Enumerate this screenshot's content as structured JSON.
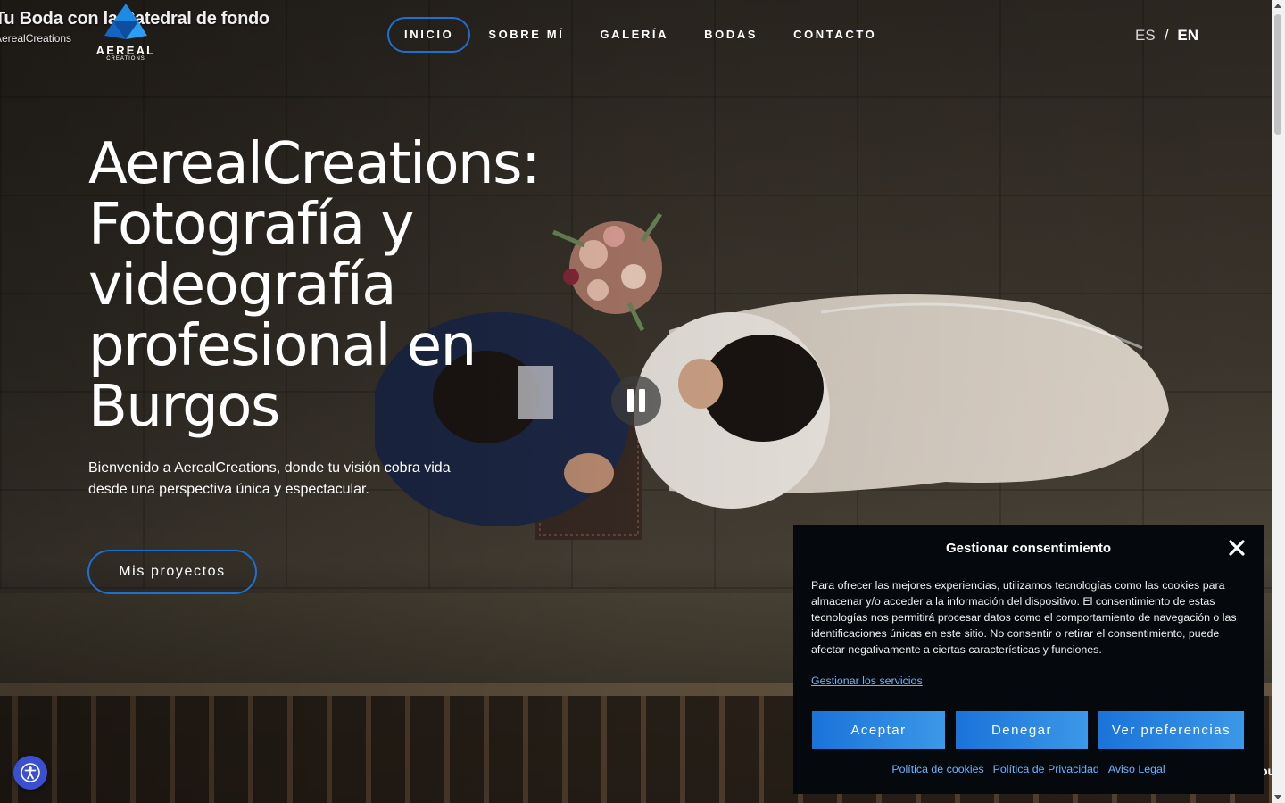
{
  "video": {
    "title": "Tu Boda con la Catedral de fondo",
    "channel": "AerealCreations",
    "pause_icon": "pause-icon"
  },
  "logo": {
    "word": "AEREAL",
    "sub": "CREATIONS",
    "color": "#1e8ae6"
  },
  "nav": {
    "items": [
      "INICIO",
      "SOBRE MÍ",
      "GALERÍA",
      "BODAS",
      "CONTACTO"
    ],
    "active_index": 0,
    "active_border_color": "#1e6fd1"
  },
  "lang": {
    "es": "ES",
    "separator": "/",
    "en": "EN"
  },
  "hero": {
    "title": "AerealCreations: Fotografía y videografía profesional en Burgos",
    "subtitle": "Bienvenido a AerealCreations, donde tu visión cobra vida desde una perspectiva única y espectacular.",
    "cta_label": "Mis proyectos"
  },
  "consent": {
    "title": "Gestionar consentimiento",
    "text": "Para ofrecer las mejores experiencias, utilizamos tecnologías como las cookies para almacenar y/o acceder a la información del dispositivo. El consentimiento de estas tecnologías nos permitirá procesar datos como el comportamiento de navegación o las identificaciones únicas en este sitio. No consentir o retirar el consentimiento, puede afectar negativamente a ciertas características y funciones.",
    "manage_link": "Gestionar los servicios",
    "accept": "Aceptar",
    "deny": "Denegar",
    "preferences": "Ver preferencias",
    "links": [
      "Política de cookies",
      "Política de Privacidad",
      "Aviso Legal"
    ],
    "button_color": "#1a73d9",
    "link_color": "#6cb4ff",
    "background": "#05080c"
  },
  "accessibility": {
    "icon": "accessibility-icon",
    "color": "#3b4fd1"
  },
  "edge": {
    "partial_text": "ou"
  }
}
